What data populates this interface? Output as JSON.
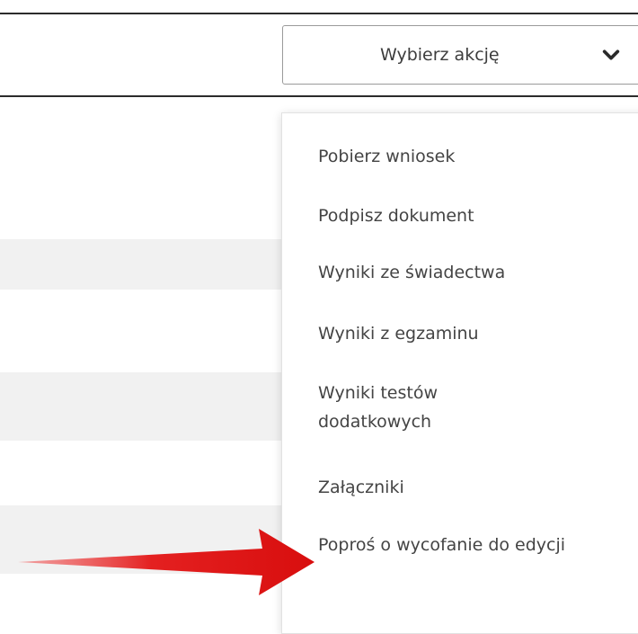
{
  "action_select": {
    "label": "Wybierz akcję",
    "chevron_icon": "chevron-down-icon"
  },
  "menu": {
    "items": [
      {
        "label": "Pobierz wniosek"
      },
      {
        "label": "Podpisz dokument"
      },
      {
        "label": "Wyniki ze świadectwa"
      },
      {
        "label": "Wyniki z egzaminu"
      },
      {
        "label": "Wyniki testów dodatkowych"
      },
      {
        "label": "Załączniki"
      },
      {
        "label": "Poproś o wycofanie do edycji"
      }
    ]
  },
  "annotation": {
    "arrow_icon": "red-arrow-icon",
    "arrow_color": "#e11b1b"
  },
  "colors": {
    "row_band": "#f1f1f1",
    "rule": "#2b2b2b",
    "text": "#444444"
  }
}
